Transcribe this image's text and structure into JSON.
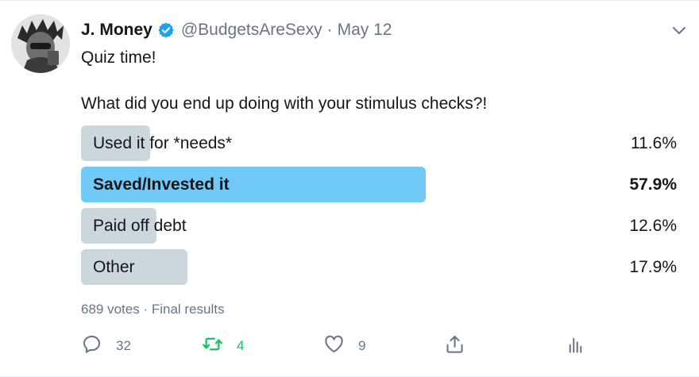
{
  "tweet": {
    "author": {
      "name": "J. Money",
      "handle": "@BudgetsAreSexy",
      "separator": "·",
      "date": "May 12"
    },
    "text_line1": "Quiz time!",
    "text_line2": "What did you end up doing with your stimulus checks?!",
    "poll": {
      "options": [
        {
          "label": "Used it for *needs*",
          "percent_label": "11.6%",
          "share": 0.116
        },
        {
          "label": "Saved/Invested it",
          "percent_label": "57.9%",
          "share": 0.579,
          "winner": true
        },
        {
          "label": "Paid off debt",
          "percent_label": "12.6%",
          "share": 0.126
        },
        {
          "label": "Other",
          "percent_label": "17.9%",
          "share": 0.179
        }
      ],
      "summary": "689 votes · Final results"
    },
    "actions": {
      "reply_count": "32",
      "retweet_count": "4",
      "like_count": "9"
    }
  },
  "colors": {
    "accent_blue": "#1da1f2",
    "winner_bar": "#71c9f8",
    "bar": "#ccd6dd",
    "retweet_green": "#17bf63",
    "muted_text": "#657786"
  },
  "icons": {
    "verified": "verified-badge-icon",
    "caret": "chevron-down-icon",
    "reply": "reply-icon",
    "retweet": "retweet-icon",
    "like": "heart-icon",
    "share": "share-icon",
    "analytics": "analytics-icon"
  }
}
